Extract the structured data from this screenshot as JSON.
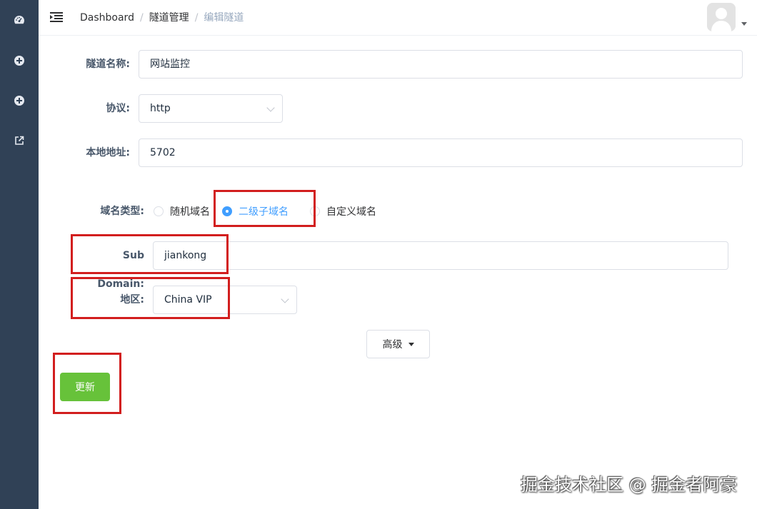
{
  "navbar": {
    "breadcrumb": [
      "Dashboard",
      "隧道管理",
      "编辑隧道"
    ],
    "separator": "/"
  },
  "sidebar": {
    "icons": [
      "dashboard-icon",
      "plus-circle-icon",
      "plus-circle-icon",
      "external-link-icon"
    ],
    "bg_color": "#304156"
  },
  "form": {
    "tunnel_name": {
      "label": "隧道名称:",
      "value": "网站监控"
    },
    "protocol": {
      "label": "协议:",
      "value": "http"
    },
    "local_address": {
      "label": "本地地址:",
      "value": "5702"
    },
    "domain_type": {
      "label": "域名类型:",
      "options": [
        {
          "label": "随机域名",
          "checked": false
        },
        {
          "label": "二级子域名",
          "checked": true
        },
        {
          "label": "自定义域名",
          "checked": false
        }
      ]
    },
    "sub_domain": {
      "label": "Sub Domain:",
      "value": "jiankong"
    },
    "region": {
      "label": "地区:",
      "value": "China VIP"
    }
  },
  "advanced_label": "高级",
  "update_label": "更新",
  "watermark": "掘金技术社区 @ 掘金者阿豪",
  "colors": {
    "accent": "#409eff",
    "success": "#67c23a",
    "highlight": "#d21e1e"
  }
}
